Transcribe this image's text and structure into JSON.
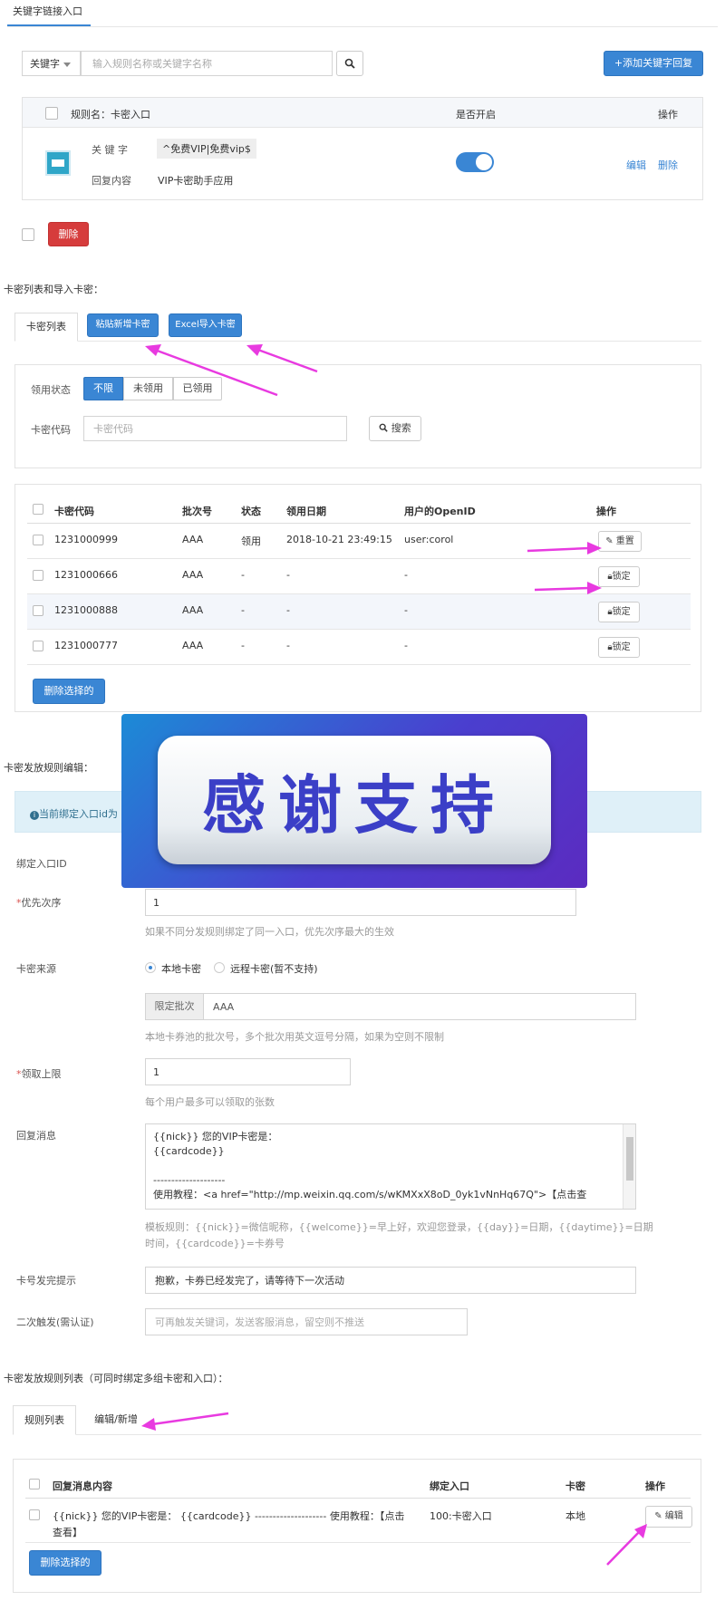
{
  "top_tab": "关键字链接入口",
  "keyword_section": {
    "filter_select": "关键字",
    "search_placeholder": "输入规则名称或关键字名称",
    "add_button": "+添加关键字回复",
    "rule_name": "规则名：卡密入口",
    "col_enabled": "是否开启",
    "col_ops": "操作",
    "keyword_label": "关 键 字",
    "keyword_value": "^免费VIP|免费vip$",
    "reply_label": "回复内容",
    "reply_value": "VIP卡密助手应用",
    "edit_link": "编辑",
    "delete_link": "删除",
    "delete_button": "删除",
    "toggle_on": true
  },
  "cardlist_section": {
    "heading": "卡密列表和导入卡密：",
    "tabs": [
      "卡密列表",
      "粘贴新增卡密",
      "Excel导入卡密"
    ],
    "status_label": "领用状态",
    "status_options": [
      "不限",
      "未领用",
      "已领用"
    ],
    "code_label": "卡密代码",
    "code_placeholder": "卡密代码",
    "search_button": "搜索",
    "table_headers": [
      "卡密代码",
      "批次号",
      "状态",
      "领用日期",
      "用户的OpenID",
      "操作"
    ],
    "rows": [
      {
        "code": "1231000999",
        "batch": "AAA",
        "status": "领用",
        "date": "2018-10-21 23:49:15",
        "openid": "user:corol",
        "op": "重置"
      },
      {
        "code": "1231000666",
        "batch": "AAA",
        "status": "-",
        "date": "-",
        "openid": "-",
        "op": "锁定"
      },
      {
        "code": "1231000888",
        "batch": "AAA",
        "status": "-",
        "date": "-",
        "openid": "-",
        "op": "锁定"
      },
      {
        "code": "1231000777",
        "batch": "AAA",
        "status": "-",
        "date": "-",
        "openid": "-",
        "op": "锁定"
      }
    ],
    "delete_selected": "删除选择的"
  },
  "rule_edit_section": {
    "heading": "卡密发放规则编辑：",
    "info_text": "当前绑定入口id为",
    "bind_label": "绑定入口ID",
    "priority_label": "优先次序",
    "priority_value": "1",
    "priority_hint": "如果不同分发规则绑定了同一入口，优先次序最大的生效",
    "source_label": "卡密来源",
    "source_options": [
      "本地卡密",
      "远程卡密(暂不支持)"
    ],
    "batch_addon": "限定批次",
    "batch_value": "AAA",
    "batch_hint": "本地卡券池的批次号，多个批次用英文逗号分隔，如果为空则不限制",
    "limit_label": "领取上限",
    "limit_value": "1",
    "limit_hint": "每个用户最多可以领取的张数",
    "reply_label": "回复消息",
    "reply_lines": [
      "{{nick}} 您的VIP卡密是：",
      "{{cardcode}}",
      "",
      "--------------------",
      "使用教程：<a href=\"http://mp.weixin.qq.com/s/wKMXxX8oD_0yk1vNnHq67Q\">【点击查"
    ],
    "reply_hint_1": "模板规则：{{nick}}=微信昵称，{{welcome}}=早上好，欢迎您登录，{{day}}=日期，{{daytime}}=日期",
    "reply_hint_2": "时间，{{cardcode}}=卡券号",
    "soldout_label": "卡号发完提示",
    "soldout_value": "抱歉，卡券已经发完了，请等待下一次活动",
    "second_label": "二次触发(需认证)",
    "second_placeholder": "可再触发关键词，发送客服消息，留空则不推送"
  },
  "overlay_banner": "感谢支持",
  "rulelist_section": {
    "heading": "卡密发放规则列表（可同时绑定多组卡密和入口）：",
    "tabs": [
      "规则列表",
      "编辑/新增"
    ],
    "table_headers": [
      "回复消息内容",
      "绑定入口",
      "卡密",
      "操作"
    ],
    "row": {
      "content_line1": "{{nick}} 您的VIP卡密是： {{cardcode}} -------------------- 使用教程：【点击",
      "content_line2": "查看】",
      "entry": "100:卡密入口",
      "card": "本地",
      "op": "编辑"
    },
    "delete_selected": "删除选择的"
  },
  "colors": {
    "accent": "#3a86d4",
    "danger": "#d63c3c",
    "annotation_arrow": "#e83ae0",
    "banner_bg": "#3b5bd9"
  }
}
